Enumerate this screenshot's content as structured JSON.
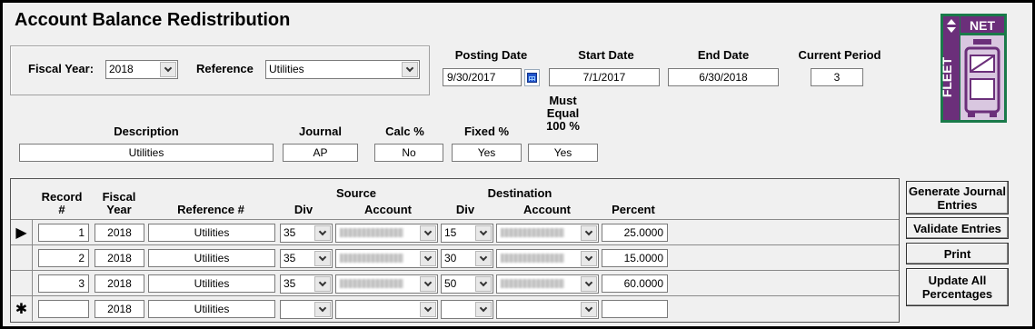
{
  "title": "Account Balance Redistribution",
  "filter": {
    "fiscal_year_label": "Fiscal Year:",
    "fiscal_year_value": "2018",
    "reference_label": "Reference",
    "reference_value": "Utilities"
  },
  "dates": {
    "posting_label": "Posting Date",
    "posting_value": "9/30/2017",
    "start_label": "Start Date",
    "start_value": "7/1/2017",
    "end_label": "End Date",
    "end_value": "6/30/2018",
    "period_label": "Current Period",
    "period_value": "3"
  },
  "details": {
    "description_label": "Description",
    "description_value": "Utilities",
    "journal_label": "Journal",
    "journal_value": "AP",
    "calc_label": "Calc %",
    "calc_value": "No",
    "fixed_label": "Fixed %",
    "fixed_value": "Yes",
    "must_equal_label_1": "Must",
    "must_equal_label_2": "Equal",
    "must_equal_label_3": "100 %",
    "must_equal_value": "Yes"
  },
  "grid": {
    "headers": {
      "record_1": "Record",
      "record_2": "#",
      "fiscal_1": "Fiscal",
      "fiscal_2": "Year",
      "reference": "Reference #",
      "source_group": "Source",
      "source_div": "Div",
      "source_account": "Account",
      "dest_group": "Destination",
      "dest_div": "Div",
      "dest_account": "Account",
      "percent": "Percent"
    },
    "rows": [
      {
        "record": "1",
        "year": "2018",
        "reference": "Utilities",
        "src_div": "35",
        "dst_div": "15",
        "percent": "25.0000"
      },
      {
        "record": "2",
        "year": "2018",
        "reference": "Utilities",
        "src_div": "35",
        "dst_div": "30",
        "percent": "15.0000"
      },
      {
        "record": "3",
        "year": "2018",
        "reference": "Utilities",
        "src_div": "35",
        "dst_div": "50",
        "percent": "60.0000"
      }
    ],
    "new_row": {
      "record": "",
      "year": "2018",
      "reference": "Utilities",
      "src_div": "",
      "dst_div": "",
      "percent": ""
    },
    "current_row_marker": "▶",
    "new_row_marker": "✱"
  },
  "buttons": {
    "generate": "Generate Journal Entries",
    "validate": "Validate Entries",
    "print": "Print",
    "update": "Update All Percentages"
  },
  "logo": {
    "text_vertical": "FLEET",
    "text_top": "NET"
  },
  "colors": {
    "logo_green": "#1a7a4a",
    "logo_purple": "#6b2f7a",
    "calendar_blue": "#2255cc"
  }
}
